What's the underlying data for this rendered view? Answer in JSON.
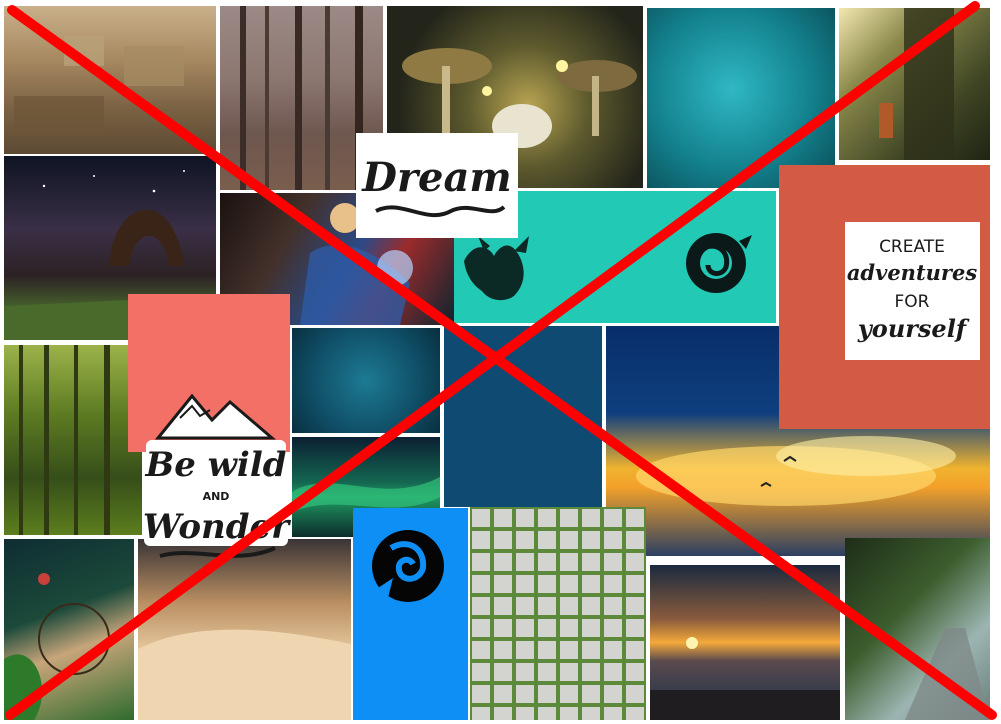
{
  "board": {
    "background": "#ffffff"
  },
  "stickers": {
    "dream": {
      "text": "Dream"
    },
    "adventures": {
      "line1": "CREATE",
      "line2": "adventures",
      "line3": "FOR",
      "line4": "yourself"
    },
    "bewild": {
      "line1": "Be wild",
      "line2": "AND",
      "line3": "Wonder"
    }
  },
  "colors": {
    "coral": "#f37066",
    "teal": "#22c9b5",
    "navy": "#0f4a72",
    "burnt_orange": "#d45b43",
    "bright_blue": "#0d8ff5",
    "cross_red": "#ff0000"
  },
  "icons": [
    "dragon-icon",
    "dragon-coil-icon",
    "phoenix-icon",
    "mountain-icon"
  ]
}
